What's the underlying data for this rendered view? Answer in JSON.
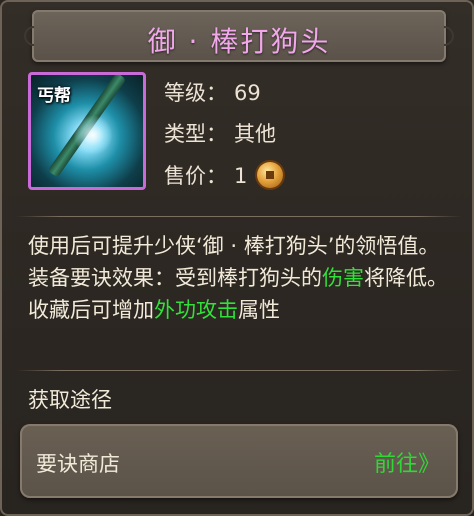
{
  "item": {
    "title": "御 · 棒打狗头",
    "icon_tag": "丐帮",
    "level_label": "等级：",
    "level_value": "69",
    "type_label": "类型：",
    "type_value": "其他",
    "price_label": "售价：",
    "price_value": "1"
  },
  "description": {
    "part1": "使用后可提升少侠‘御 · 棒打狗头’的领悟值。装备要诀效果：受到棒打狗头的",
    "highlight1": "伤害",
    "part2": "将降低。",
    "part3": "收藏后可增加",
    "highlight2": "外功攻击",
    "part4": "属性"
  },
  "source": {
    "label": "获取途径",
    "shop_name": "要诀商店",
    "go_label": "前往》"
  },
  "colors": {
    "title": "#f0a8ea",
    "highlight": "#32e03a",
    "icon_border": "#c86ad8"
  }
}
